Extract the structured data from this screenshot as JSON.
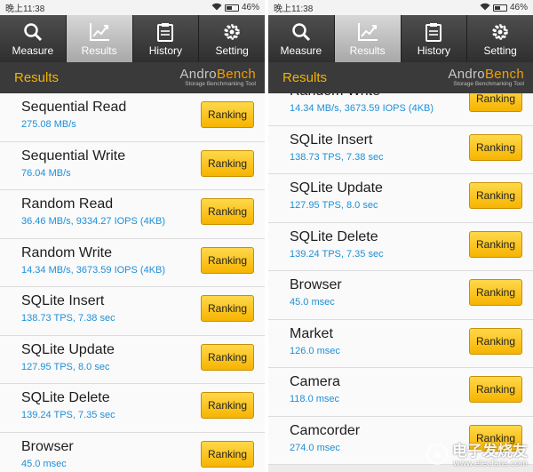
{
  "tabs": [
    {
      "label": "Measure",
      "icon": "search-icon"
    },
    {
      "label": "Results",
      "icon": "chart-icon",
      "active": true
    },
    {
      "label": "History",
      "icon": "clipboard-icon"
    },
    {
      "label": "Setting",
      "icon": "gear-icon"
    }
  ],
  "status": {
    "time": "晚上11:38",
    "battery": "46%"
  },
  "header": {
    "title": "Results",
    "brand_andro": "Andro",
    "brand_bench": "Bench",
    "brand_tagline": "Storage Benchmarking Tool"
  },
  "ranking_label": "Ranking",
  "left": {
    "items": [
      {
        "name": "Sequential Read",
        "value": "275.08 MB/s"
      },
      {
        "name": "Sequential Write",
        "value": "76.04 MB/s"
      },
      {
        "name": "Random Read",
        "value": "36.46 MB/s, 9334.27 IOPS (4KB)"
      },
      {
        "name": "Random Write",
        "value": "14.34 MB/s, 3673.59 IOPS (4KB)"
      },
      {
        "name": "SQLite Insert",
        "value": "138.73 TPS, 7.38 sec"
      },
      {
        "name": "SQLite Update",
        "value": "127.95 TPS, 8.0 sec"
      },
      {
        "name": "SQLite Delete",
        "value": "139.24 TPS, 7.35 sec"
      },
      {
        "name": "Browser",
        "value": "45.0 msec"
      }
    ]
  },
  "right": {
    "items": [
      {
        "name": "Random Write",
        "value": "14.34 MB/s, 3673.59 IOPS (4KB)"
      },
      {
        "name": "SQLite Insert",
        "value": "138.73 TPS, 7.38 sec"
      },
      {
        "name": "SQLite Update",
        "value": "127.95 TPS, 8.0 sec"
      },
      {
        "name": "SQLite Delete",
        "value": "139.24 TPS, 7.35 sec"
      },
      {
        "name": "Browser",
        "value": "45.0 msec"
      },
      {
        "name": "Market",
        "value": "126.0 msec"
      },
      {
        "name": "Camera",
        "value": "118.0 msec"
      },
      {
        "name": "Camcorder",
        "value": "274.0 msec"
      }
    ]
  },
  "watermark": {
    "cn": "电子发烧友",
    "url": "www.elecfans.com"
  },
  "colors": {
    "accent": "#f0b400",
    "value_blue": "#1e8fd8",
    "button_yellow": "#f6b400"
  }
}
